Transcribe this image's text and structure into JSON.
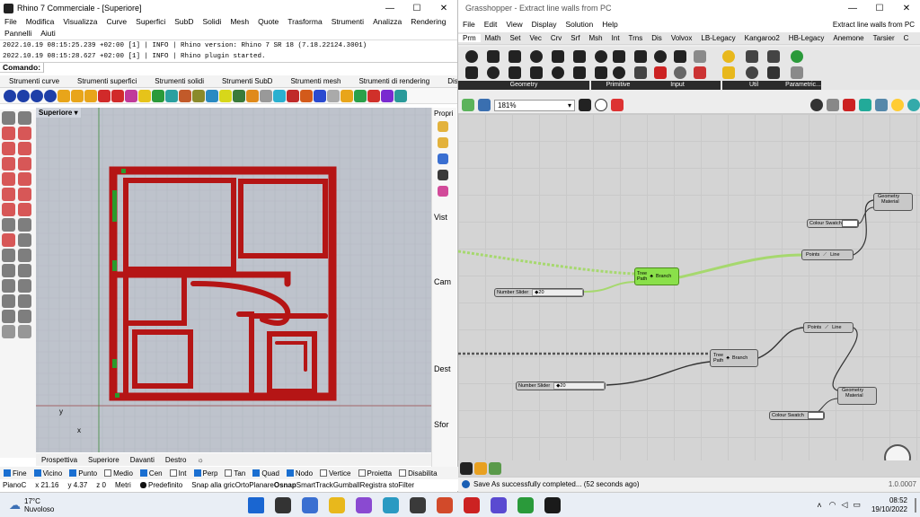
{
  "rhino": {
    "title": "Rhino 7 Commerciale - [Superiore]",
    "menu": [
      "File",
      "Modifica",
      "Visualizza",
      "Curve",
      "Superfici",
      "SubD",
      "Solidi",
      "Mesh",
      "Quote",
      "Trasforma",
      "Strumenti",
      "Analizza",
      "Rendering",
      "Pannelli",
      "Aiuti"
    ],
    "history": [
      "2022.10.19 08:15:25.239 +02:00 [1] | INFO | Rhino version: Rhino 7 SR 18 (7.18.22124.3001)",
      "2022.10.19 08:15:28.627 +02:00 [1] | INFO | Rhino plugin started."
    ],
    "command_label": "Comando:",
    "toolbar_tabs": [
      "Strumenti curve",
      "Strumenti superfici",
      "Strumenti solidi",
      "Strumenti SubD",
      "Strumenti mesh",
      "Strumenti di rendering",
      "Dis"
    ],
    "viewport_label": "Superiore",
    "axis_x": "x",
    "axis_y": "y",
    "viewport_tabs": [
      "Prospettiva",
      "Superiore",
      "Davanti",
      "Destro"
    ],
    "right_panel": [
      "Propri",
      "Vist",
      "Cam",
      "Dest",
      "Sfor"
    ],
    "osnaps": [
      {
        "label": "Fine",
        "on": true
      },
      {
        "label": "Vicino",
        "on": true
      },
      {
        "label": "Punto",
        "on": true
      },
      {
        "label": "Medio",
        "on": false
      },
      {
        "label": "Cen",
        "on": true
      },
      {
        "label": "Int",
        "on": false
      },
      {
        "label": "Perp",
        "on": true
      },
      {
        "label": "Tan",
        "on": false
      },
      {
        "label": "Quad",
        "on": true
      },
      {
        "label": "Nodo",
        "on": true
      },
      {
        "label": "Vertice",
        "on": false
      },
      {
        "label": "Proietta",
        "on": false
      },
      {
        "label": "Disabilita",
        "on": false
      }
    ],
    "status": {
      "plane": "PianoC",
      "x": "x 21.16",
      "y": "y 4.37",
      "z": "z 0",
      "units": "Metri",
      "layer": "Predefinito",
      "modes": [
        "Snap alla gric",
        "Orto",
        "Planare",
        "Osnap",
        "SmartTrack",
        "Gumball",
        "Registra sto",
        "Filter"
      ]
    }
  },
  "gh": {
    "title": "Grasshopper - Extract line walls from PC",
    "menu": [
      "File",
      "Edit",
      "View",
      "Display",
      "Solution",
      "Help"
    ],
    "doc_name": "Extract line walls from PC",
    "tabs": [
      "Prm",
      "Math",
      "Set",
      "Vec",
      "Crv",
      "Srf",
      "Msh",
      "Int",
      "Trns",
      "Dis",
      "Volvox",
      "LB-Legacy",
      "Kangaroo2",
      "HB-Legacy",
      "Anemone",
      "Tarsier",
      "C"
    ],
    "groups": [
      "Geometry",
      "Primitive",
      "Input",
      "Util",
      "Parametric..."
    ],
    "zoom": "181%",
    "nodes": {
      "geom1": {
        "in": "Geometry",
        "mat": "Material"
      },
      "swatch1": "Colour Swatch",
      "line1": {
        "in": "Points",
        "out": "Line"
      },
      "branch1": {
        "a": "Tree",
        "b": "Path",
        "out": "Branch"
      },
      "slider1": {
        "label": "Number Slider",
        "val": "20"
      },
      "line2": {
        "in": "Points",
        "out": "Line"
      },
      "branch2": {
        "a": "Tree",
        "b": "Path",
        "out": "Branch"
      },
      "slider2": {
        "label": "Number Slider",
        "val": "20"
      },
      "geom2": {
        "in": "Geometry",
        "mat": "Material"
      },
      "swatch2": "Colour Swatch"
    },
    "status": "Save As successfully completed... (52 seconds ago)",
    "version": "1.0.0007"
  },
  "taskbar": {
    "temp": "17°C",
    "weather": "Nuvoloso",
    "time": "08:52",
    "date": "19/10/2022"
  }
}
